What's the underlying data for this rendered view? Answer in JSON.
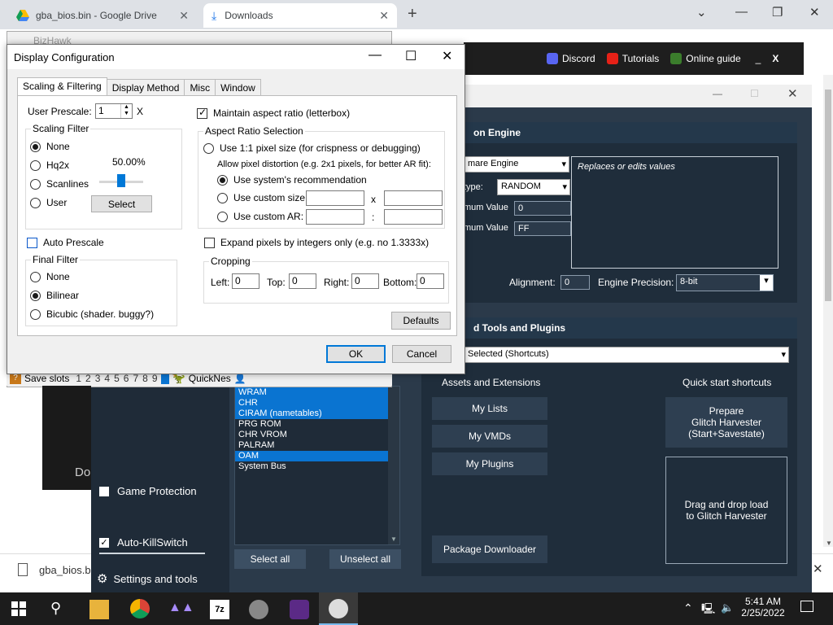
{
  "browser": {
    "tabs": [
      {
        "title": "gba_bios.bin - Google Drive",
        "icon": "google-drive-icon"
      },
      {
        "title": "Downloads",
        "icon": "download-icon"
      }
    ],
    "new_tab": "+",
    "download_file": "gba_bios.bi"
  },
  "bizhawk_bar": {
    "discord": "Discord",
    "tutorials": "Tutorials",
    "online_guide": "Online guide",
    "minimize": "_",
    "close": "X"
  },
  "bizhawk_window": {
    "title": "BizHawk",
    "save_slots_label": "Save slots",
    "slots": [
      "1",
      "2",
      "3",
      "4",
      "5",
      "6",
      "7",
      "8",
      "9"
    ],
    "core": "QuickNes",
    "partial_text": "Do"
  },
  "dialog": {
    "title": "Display Configuration",
    "tabs": [
      "Scaling & Filtering",
      "Display Method",
      "Misc",
      "Window"
    ],
    "user_prescale_label": "User Prescale:",
    "user_prescale_value": "1",
    "prescale_x": "X",
    "scaling_filter": {
      "label": "Scaling Filter",
      "options": [
        "None",
        "Hq2x",
        "Scanlines",
        "User"
      ],
      "selected": "None",
      "percent": "50.00%",
      "percent_value": 0.5,
      "select_button": "Select"
    },
    "auto_prescale": "Auto Prescale",
    "final_filter": {
      "label": "Final Filter",
      "options": [
        "None",
        "Bilinear",
        "Bicubic (shader. buggy?)"
      ],
      "selected": "Bilinear"
    },
    "maintain_aspect": "Maintain aspect ratio (letterbox)",
    "aspect": {
      "label": "Aspect Ratio Selection",
      "use_1to1": "Use 1:1 pixel size (for crispness or debugging)",
      "allow_distortion": "Allow pixel distortion (e.g. 2x1 pixels, for better AR fit):",
      "use_system": "Use system's recommendation",
      "use_custom_size": "Use custom size:",
      "size_sep": "x",
      "use_custom_ar": "Use custom AR:",
      "ar_sep": ":"
    },
    "expand_pixels": "Expand pixels by integers only (e.g. no 1.3333x)",
    "cropping": {
      "label": "Cropping",
      "left_label": "Left:",
      "left": "0",
      "top_label": "Top:",
      "top": "0",
      "right_label": "Right:",
      "right": "0",
      "bottom_label": "Bottom:",
      "bottom": "0"
    },
    "defaults": "Defaults",
    "ok": "OK",
    "cancel": "Cancel"
  },
  "rtc": {
    "engine_header": "on Engine",
    "engine_select": "mare Engine",
    "engine_desc": "Replaces or edits values",
    "type_label": "type:",
    "type_value": "RANDOM",
    "min_label": "mum Value",
    "min_value": "0",
    "max_label": "mum Value",
    "max_value": "FF",
    "alignment_label": "Alignment:",
    "alignment_value": "0",
    "precision_label": "Engine Precision:",
    "precision_value": "8-bit",
    "tools_header": "d Tools and Plugins",
    "tools_select": "Selected (Shortcuts)",
    "assets_label": "Assets and Extensions",
    "quickstart_label": "Quick start shortcuts",
    "my_lists": "My Lists",
    "my_vmds": "My VMDs",
    "my_plugins": "My Plugins",
    "prepare": "Prepare\nGlitch Harvester\n(Start+Savestate)",
    "drag_drop": "Drag and drop load\nto Glitch Harvester",
    "package_downloader": "Package Downloader",
    "domains": [
      {
        "name": "WRAM",
        "selected": true
      },
      {
        "name": "CHR",
        "selected": true
      },
      {
        "name": "CIRAM (nametables)",
        "selected": true
      },
      {
        "name": "PRG ROM",
        "selected": false
      },
      {
        "name": "CHR VROM",
        "selected": false
      },
      {
        "name": "PALRAM",
        "selected": false
      },
      {
        "name": "OAM",
        "selected": true
      },
      {
        "name": "System Bus",
        "selected": false
      }
    ],
    "select_all": "Select all",
    "unselect_all": "Unselect all",
    "game_protection": "Game Protection",
    "auto_killswitch": "Auto-KillSwitch",
    "settings": "Settings and tools"
  },
  "taskbar": {
    "time": "5:41 AM",
    "date": "2/25/2022"
  },
  "colors": {
    "rtc_bg": "#2b3a4a",
    "selection_blue": "#0a74d1",
    "taskbar": "#1c1c1c"
  }
}
